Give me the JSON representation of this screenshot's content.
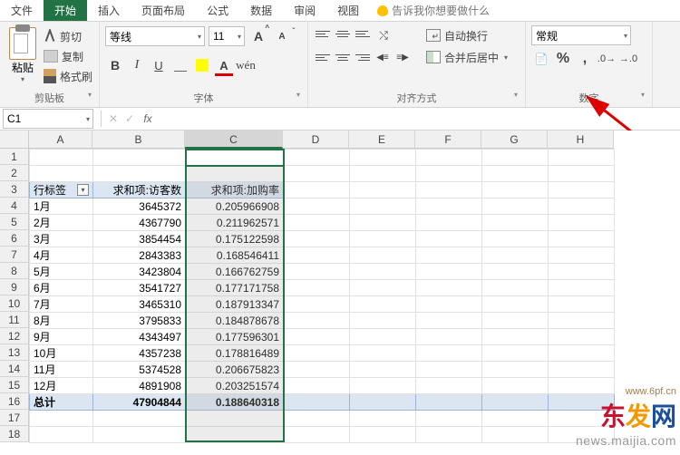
{
  "menu": {
    "file": "文件",
    "home": "开始",
    "insert": "插入",
    "page_layout": "页面布局",
    "formulas": "公式",
    "data": "数据",
    "review": "审阅",
    "view": "视图",
    "tell_me": "告诉我你想要做什么"
  },
  "ribbon": {
    "clipboard": {
      "paste": "粘贴",
      "cut": "剪切",
      "copy": "复制",
      "format_painter": "格式刷",
      "label": "剪贴板"
    },
    "font": {
      "name": "等线",
      "size": "11",
      "label": "字体",
      "bold": "B",
      "italic": "I",
      "underline": "U",
      "wen": "wén"
    },
    "alignment": {
      "wrap": "自动换行",
      "merge": "合并后居中",
      "label": "对齐方式"
    },
    "number": {
      "format": "常规",
      "currency": "%",
      "comma": ",",
      "label": "数字"
    }
  },
  "name_box": "C1",
  "formula": "",
  "columns": [
    "A",
    "B",
    "C",
    "D",
    "E",
    "F",
    "G",
    "H"
  ],
  "row_count": 18,
  "table": {
    "headers": {
      "a": "行标签",
      "b": "求和项:访客数",
      "c": "求和项:加购率"
    },
    "rows": [
      {
        "a": "1月",
        "b": "3645372",
        "c": "0.205966908"
      },
      {
        "a": "2月",
        "b": "4367790",
        "c": "0.211962571"
      },
      {
        "a": "3月",
        "b": "3854454",
        "c": "0.175122598"
      },
      {
        "a": "4月",
        "b": "2843383",
        "c": "0.168546411"
      },
      {
        "a": "5月",
        "b": "3423804",
        "c": "0.166762759"
      },
      {
        "a": "6月",
        "b": "3541727",
        "c": "0.177171758"
      },
      {
        "a": "7月",
        "b": "3465310",
        "c": "0.187913347"
      },
      {
        "a": "8月",
        "b": "3795833",
        "c": "0.184878678"
      },
      {
        "a": "9月",
        "b": "4343497",
        "c": "0.177596301"
      },
      {
        "a": "10月",
        "b": "4357238",
        "c": "0.178816489"
      },
      {
        "a": "11月",
        "b": "5374528",
        "c": "0.206675823"
      },
      {
        "a": "12月",
        "b": "4891908",
        "c": "0.203251574"
      }
    ],
    "total": {
      "a": "总计",
      "b": "47904844",
      "c": "0.188640318"
    }
  },
  "watermark": {
    "brand": "东发网",
    "url": "news.maijia.com",
    "small": "www.6pf.cn"
  }
}
